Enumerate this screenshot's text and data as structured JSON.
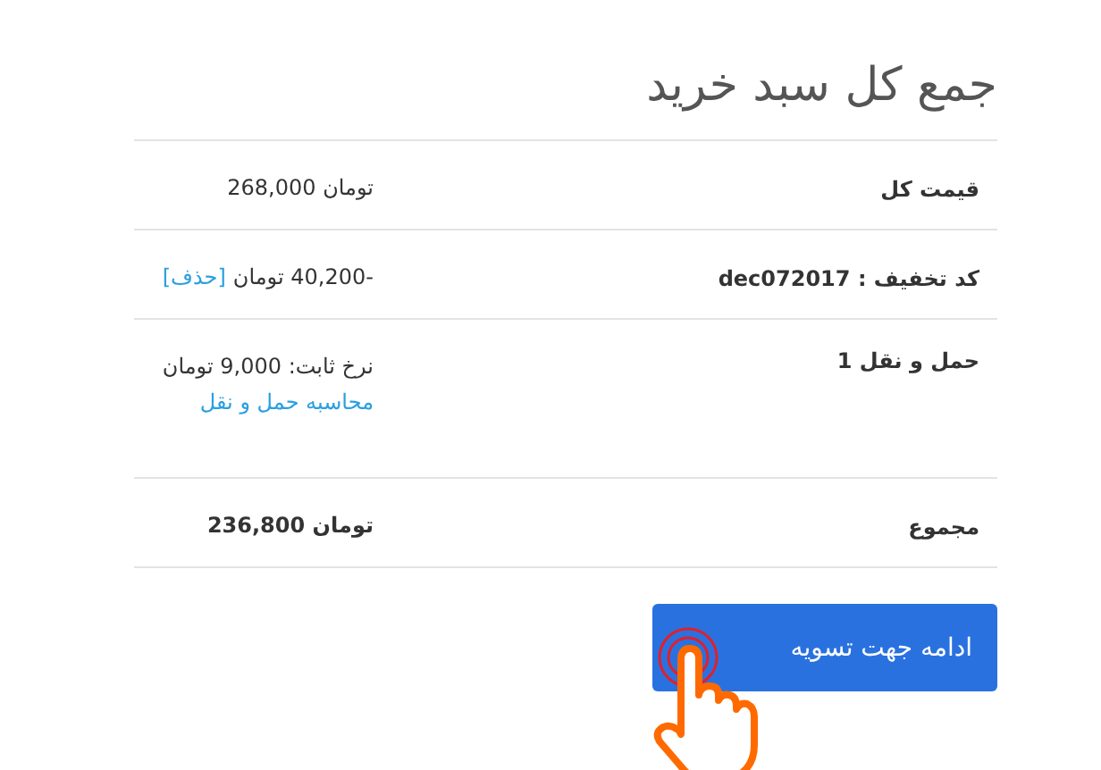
{
  "title": "جمع کل سبد خرید",
  "rows": [
    {
      "kind": "amount",
      "label": "قیمت کل",
      "value": "تومان 268,000"
    },
    {
      "kind": "discount",
      "label": "کد تخفیف : dec072017",
      "value": "-40,200 تومان",
      "link": "[حذف]"
    },
    {
      "kind": "shipping",
      "label": "حمل و نقل 1",
      "value": "نرخ ثابت: 9,000 تومان",
      "link": "محاسبه حمل و نقل"
    },
    {
      "kind": "total",
      "label": "مجموع",
      "value": "تومان 236,800"
    }
  ],
  "button": {
    "label": "ادامه جهت تسویه"
  }
}
